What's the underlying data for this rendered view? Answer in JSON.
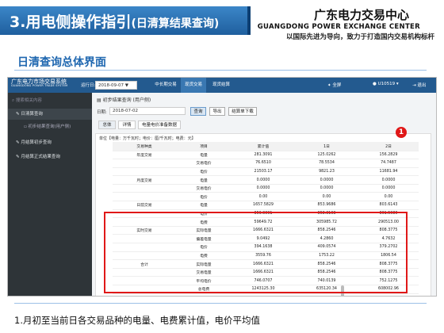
{
  "slide": {
    "title": "3.用电侧操作指引",
    "title_sub": "(日清算结果查询)",
    "brand_cn": "广东电力交易中心",
    "brand_en": "GUANGDONG POWER EXCHANGE CENTER",
    "brand_slogan": "以国际先进为导向，致力于打造国内交易机构标杆",
    "section": "日清查询总体界面",
    "note": "1.月初至当前日各交易品种的电量、电费累计值，电价平均值",
    "badge": "1"
  },
  "app": {
    "logo_cn": "广东电力市场交易系统",
    "logo_en": "GUANGDONG POWER TRADE SYSTEM",
    "period_label": "运行日:",
    "period_value": "2018-09-07 ▼",
    "nav": [
      "中长期交易",
      "现货交易",
      "现货结算"
    ],
    "fullscreen": "全屏",
    "user": "U10519 ▾",
    "exit": "退出",
    "sidebar": {
      "search": "搜索相关内容",
      "items": [
        "日清算查询",
        "初步结果查询(用户侧)",
        "月结算初步查询",
        "月结算正式结果查询"
      ]
    },
    "breadcrumb": "初步结果查询 (用户侧)",
    "date_label": "日期:",
    "date_value": "2018-07-02",
    "buttons": [
      "查询",
      "导出",
      "结算单下载"
    ],
    "subtabs": [
      "总体",
      "详情",
      "电量电价准备数据"
    ],
    "unit": "单位【电量：万千瓦时；电价：厘/千瓦时；电费：元】",
    "table": {
      "headers": [
        "交易种类",
        "项目",
        "累计值",
        "1日",
        "2日"
      ],
      "rows": [
        [
          "年度交易",
          "电量",
          "281.3091",
          "125.0262",
          "156.2829"
        ],
        [
          "",
          "交易电价",
          "76.6510",
          "78.5534",
          "74.7487"
        ],
        [
          "",
          "电价",
          "21503.17",
          "9821.23",
          "11681.94"
        ],
        [
          "月度交易",
          "电量",
          "0.0000",
          "0.0000",
          "0.0000"
        ],
        [
          "",
          "交易电价",
          "0.0000",
          "0.0000",
          "0.0000"
        ],
        [
          "",
          "电价",
          "0.00",
          "0.00",
          "0.00"
        ],
        [
          "日前交易",
          "电量",
          "1657.5829",
          "853.9686",
          "803.6143"
        ],
        [
          "",
          "电价",
          "359.9091",
          "358.3103",
          "361.5080"
        ],
        [
          "",
          "电费",
          "59649.72",
          "305985.72",
          "290513.00"
        ],
        [
          "实时交易",
          "实际电量",
          "1666.6321",
          "858.2546",
          "808.3775"
        ],
        [
          "",
          "偏差电量",
          "9.0492",
          "4.2860",
          "4.7632"
        ],
        [
          "",
          "电价",
          "394.1638",
          "409.0574",
          "379.2702"
        ],
        [
          "",
          "电费",
          "3559.76",
          "1753.22",
          "1806.54"
        ],
        [
          "合计",
          "实际电量",
          "1666.6321",
          "858.2546",
          "808.3775"
        ],
        [
          "",
          "交易电量",
          "1666.6321",
          "858.2546",
          "808.3775"
        ],
        [
          "",
          "平均电价",
          "746.0707",
          "740.0139",
          "752.1275"
        ],
        [
          "",
          "总电费",
          "1243125.30",
          "635120.34",
          "608002.96"
        ]
      ]
    }
  }
}
